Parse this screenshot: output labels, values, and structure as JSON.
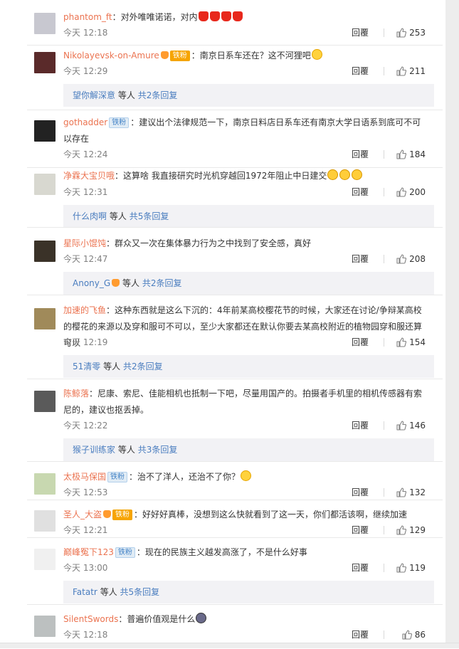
{
  "comments": [
    {
      "user": "phantom_ft",
      "badge": "",
      "text": "：对外唯唯诺诺，对内",
      "emojis": [
        "candle",
        "candle",
        "candle",
        "candle"
      ],
      "time": "今天 12:18",
      "reply": "回覆",
      "likes": "253",
      "sub": null
    },
    {
      "user": "Nikolayevsk-on-Amure",
      "badge": "铁粉",
      "text": "：南京日系车还在？这不河狸吧",
      "emojis": [
        "face"
      ],
      "time": "今天 12:29",
      "reply": "回覆",
      "likes": "211",
      "sub": {
        "who": "望你解深意",
        "mid": "等人",
        "count": "共2条回复"
      }
    },
    {
      "user": "gothadder",
      "badge": "铁粉",
      "text": "：建议出个法律规范一下，南京日料店日系车还有南京大学日语系到底可不可以存在",
      "emojis": [],
      "time": "今天 12:24",
      "reply": "回覆",
      "likes": "184",
      "sub": null
    },
    {
      "user": "净霖大宝贝哦",
      "badge": "",
      "text": "：这算啥 我直接研究时光机穿越回1972年阻止中日建交",
      "emojis": [
        "cry",
        "cry",
        "cry"
      ],
      "time": "今天 12:31",
      "reply": "回覆",
      "likes": "200",
      "sub": {
        "who": "什么肉啊",
        "mid": "等人",
        "count": "共5条回复"
      }
    },
    {
      "user": "星际小馄饨",
      "badge": "",
      "text": "：群众又一次在集体暴力行为之中找到了安全感，真好",
      "emojis": [],
      "time": "今天 12:47",
      "reply": "回覆",
      "likes": "208",
      "sub": {
        "who": "Anony_G",
        "mid": "等人",
        "count": "共2条回复"
      }
    },
    {
      "user": "加速的飞鱼",
      "badge": "",
      "text": "：这种东西就是这么下沉的：4年前某高校樱花节的时候，大家还在讨论/争辩某高校的樱花的来源以及穿和服可不可以，至少大家都还在默认你要去某高校附近的植物园穿和服还算可以",
      "emojis": [],
      "time": "今天 12:19",
      "reply": "回覆",
      "likes": "154",
      "sub": {
        "who": "51清零",
        "mid": "等人",
        "count": "共2条回复"
      }
    },
    {
      "user": "陈鲸落",
      "badge": "",
      "text": "：尼康、索尼、佳能相机也抵制一下吧，尽量用国产的。拍摄者手机里的相机传感器有索尼的，建议也抠丢掉。",
      "emojis": [],
      "time": "今天 12:22",
      "reply": "回覆",
      "likes": "146",
      "sub": {
        "who": "猴子训练家",
        "mid": "等人",
        "count": "共3条回复"
      }
    },
    {
      "user": "太极马保国",
      "badge": "铁粉",
      "text": "：治不了洋人，还治不了你？",
      "emojis": [
        "face"
      ],
      "time": "今天 12:53",
      "reply": "回覆",
      "likes": "132",
      "sub": null
    },
    {
      "user": "圣人_大盗",
      "badge": "铁粉",
      "text": "：好好好真棒，没想到这么快就看到了这一天，你们都活该啊，继续加速",
      "emojis": [],
      "time": "今天 12:21",
      "reply": "回覆",
      "likes": "129",
      "sub": null
    },
    {
      "user": "巅峰冤下123",
      "badge": "铁粉",
      "text": "：现在的民族主义越发高涨了，不是什么好事",
      "emojis": [],
      "time": "今天 13:00",
      "reply": "回覆",
      "likes": "119",
      "sub": {
        "who": "Fatatr",
        "mid": "等人",
        "count": "共5条回复"
      }
    },
    {
      "user": "SilentSwords",
      "badge": "",
      "text": "：普遍价值观是什么",
      "emojis": [
        "dark"
      ],
      "time": "今天 12:18",
      "reply": "回覆",
      "likes": "86",
      "sub": null
    }
  ],
  "avatar_colors": [
    "#c8c8d0",
    "#5a2a2a",
    "#222222",
    "#d8d8d0",
    "#3a3228",
    "#a08a5a",
    "#5a5a5a",
    "#c8d8b0",
    "#e0e0e0",
    "#f0f0f0",
    "#bcc0c0"
  ]
}
